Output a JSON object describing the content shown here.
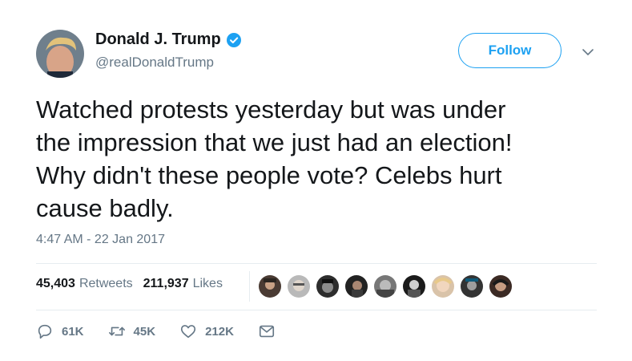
{
  "user": {
    "display_name": "Donald J. Trump",
    "handle": "@realDonaldTrump",
    "verified": true
  },
  "follow_label": "Follow",
  "tweet": {
    "text": "Watched protests yesterday but was under\nthe impression that we just had an election!\nWhy didn't these people vote? Celebs hurt\ncause badly.",
    "timestamp": "4:47 AM - 22 Jan 2017"
  },
  "stats": {
    "retweets_count": "45,403",
    "retweets_label": "Retweets",
    "likes_count": "211,937",
    "likes_label": "Likes"
  },
  "liker_avatars": 9,
  "actions": {
    "replies": "61K",
    "retweets": "45K",
    "likes": "212K"
  },
  "colors": {
    "accent": "#1da1f2",
    "text": "#14171a",
    "muted": "#657786",
    "divider": "#e6ecf0"
  },
  "icons": [
    "verified-badge-icon",
    "chevron-down-icon",
    "reply-icon",
    "retweet-icon",
    "like-heart-icon",
    "direct-message-icon"
  ]
}
